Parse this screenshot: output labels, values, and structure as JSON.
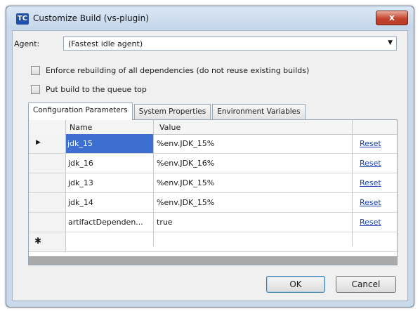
{
  "window": {
    "title": "Customize Build (vs-plugin)",
    "close_label": "x",
    "icon_text": "TC"
  },
  "agent": {
    "label": "Agent:",
    "value": "(Fastest idle agent)"
  },
  "options": [
    {
      "label": "Enforce rebuilding of all dependencies (do not reuse existing builds)"
    },
    {
      "label": "Put build to the queue top"
    }
  ],
  "tabs": [
    {
      "label": "Configuration Parameters"
    },
    {
      "label": "System Properties"
    },
    {
      "label": "Environment Variables"
    }
  ],
  "grid": {
    "columns": [
      "Name",
      "Value"
    ],
    "rows": [
      {
        "name": "jdk_15",
        "value": "%env.JDK_15%",
        "action": "Reset",
        "selected": true
      },
      {
        "name": "jdk_16",
        "value": "%env.JDK_16%",
        "action": "Reset"
      },
      {
        "name": "jdk_13",
        "value": "%env.JDK_15%",
        "action": "Reset"
      },
      {
        "name": "jdk_14",
        "value": "%env.JDK_15%",
        "action": "Reset"
      },
      {
        "name": "artifactDependen...",
        "value": "true",
        "action": "Reset"
      }
    ],
    "row_marker": "▶",
    "new_row_marker": "✱"
  },
  "buttons": {
    "ok": "OK",
    "cancel": "Cancel"
  }
}
